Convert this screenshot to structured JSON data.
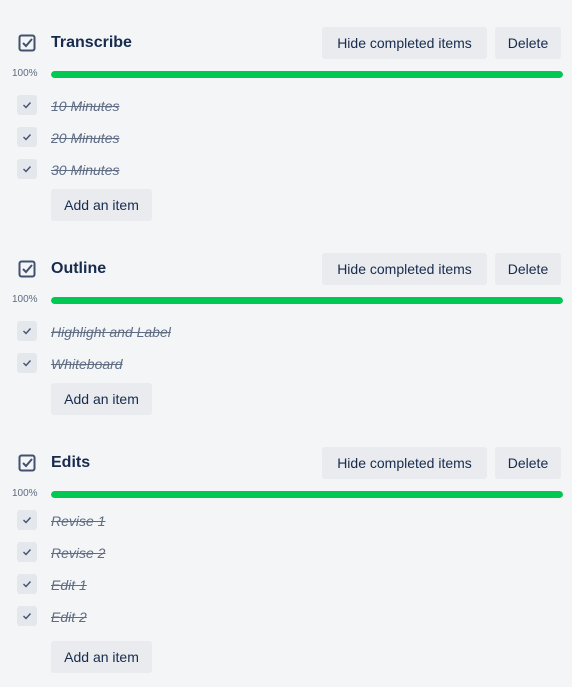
{
  "colors": {
    "background": "#f4f5f7",
    "progress_fill": "#00c853",
    "button_bg": "#e9ebee",
    "text_primary": "#172b4d",
    "text_muted": "#5e6c84"
  },
  "checklists": [
    {
      "title": "Transcribe",
      "hide_label": "Hide completed items",
      "delete_label": "Delete",
      "percent_label": "100%",
      "progress": 1.0,
      "items": [
        {
          "label": "10 Minutes",
          "checked": true
        },
        {
          "label": "20 Minutes",
          "checked": true
        },
        {
          "label": "30 Minutes",
          "checked": true
        }
      ],
      "add_label": "Add an item"
    },
    {
      "title": "Outline",
      "hide_label": "Hide completed items",
      "delete_label": "Delete",
      "percent_label": "100%",
      "progress": 1.0,
      "items": [
        {
          "label": "Highlight and Label",
          "checked": true
        },
        {
          "label": "Whiteboard",
          "checked": true
        }
      ],
      "add_label": "Add an item"
    },
    {
      "title": "Edits",
      "hide_label": "Hide completed items",
      "delete_label": "Delete",
      "percent_label": "100%",
      "progress": 1.0,
      "items": [
        {
          "label": "Revise 1",
          "checked": true
        },
        {
          "label": "Revise 2",
          "checked": true
        },
        {
          "label": "Edit 1",
          "checked": true
        },
        {
          "label": "Edit 2",
          "checked": true
        }
      ],
      "add_label": "Add an item"
    }
  ]
}
